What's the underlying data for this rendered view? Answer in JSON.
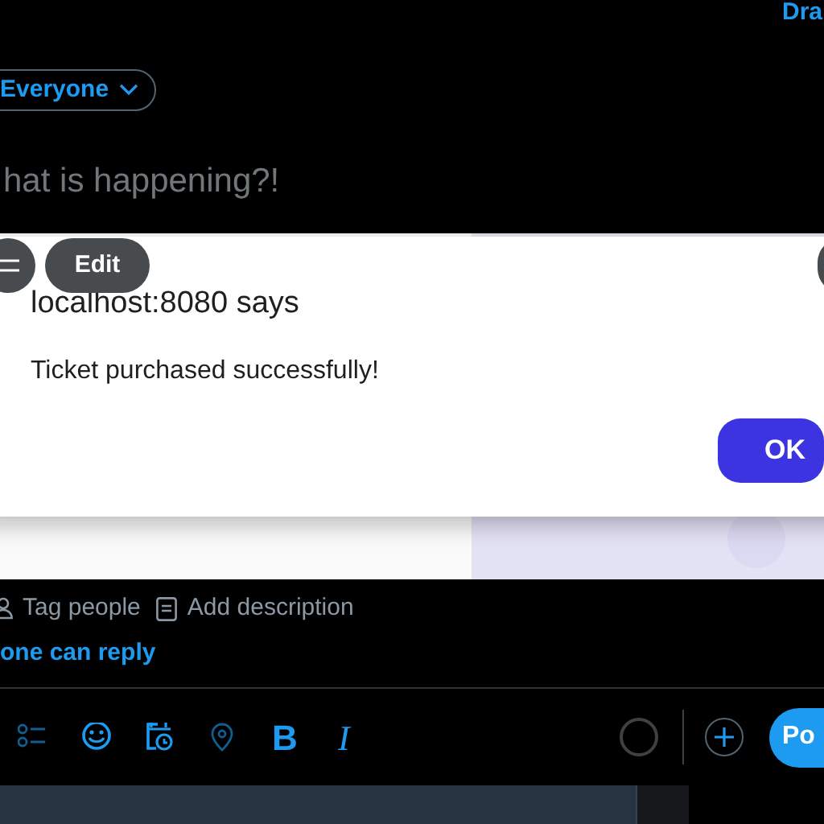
{
  "header": {
    "drafts_link": "Dra"
  },
  "audience": {
    "label": "Everyone"
  },
  "composer": {
    "placeholder": "hat is happening?!"
  },
  "media": {
    "edit_button": "Edit"
  },
  "alert": {
    "title": "localhost:8080 says",
    "message": "Ticket purchased successfully!",
    "ok_button": "OK"
  },
  "media_actions": [
    {
      "kind": "tag",
      "label": "Tag people"
    },
    {
      "kind": "description",
      "label": "Add description"
    }
  ],
  "reply_setting": "one can reply",
  "toolbar": {
    "format_buttons": [
      {
        "kind": "bold",
        "label": "B"
      },
      {
        "kind": "italic",
        "label": "I"
      }
    ],
    "post_button": "Po"
  }
}
